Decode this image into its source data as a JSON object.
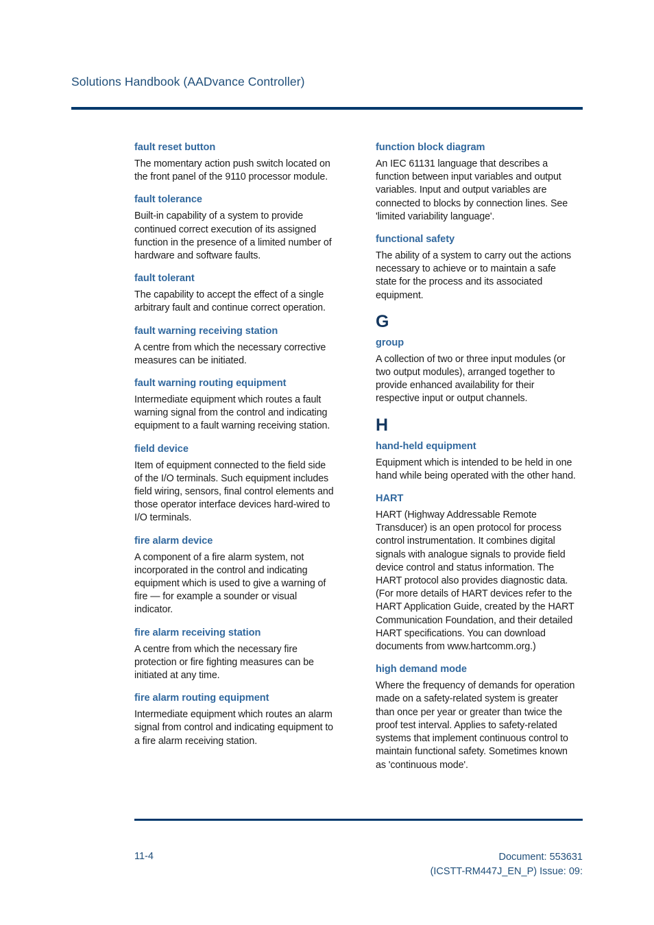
{
  "document": {
    "header_title": "Solutions Handbook (AADvance Controller)",
    "accent_rule_color": "#00386B",
    "term_color": "#31689E",
    "letter_color": "#13365E",
    "footer_color": "#1F4E79"
  },
  "columns": {
    "left": [
      {
        "kind": "entry",
        "term": "fault reset button",
        "definition": "The momentary action push switch located on the front panel of the 9110 processor module."
      },
      {
        "kind": "entry",
        "term": "fault tolerance",
        "definition": "Built-in capability of a system to provide continued correct execution of its assigned function in the presence of a limited number of hardware and software faults."
      },
      {
        "kind": "entry",
        "term": "fault tolerant",
        "definition": "The capability to accept the effect of a single arbitrary fault and continue correct operation."
      },
      {
        "kind": "entry",
        "term": "fault warning receiving station",
        "definition": "A centre from which the necessary corrective measures can be initiated."
      },
      {
        "kind": "entry",
        "term": "fault warning routing equipment",
        "definition": "Intermediate equipment which routes a fault warning signal from the control and indicating equipment to a fault warning receiving station."
      },
      {
        "kind": "entry",
        "term": "field device",
        "definition": "Item of equipment connected to the field side of the I/O terminals. Such equipment includes field wiring, sensors, final control elements and those operator interface devices hard-wired to I/O terminals."
      },
      {
        "kind": "entry",
        "term": "fire alarm device",
        "definition": "A component of a fire alarm system, not incorporated in the control and indicating equipment which is used to give a warning of fire — for example a sounder or visual indicator."
      },
      {
        "kind": "entry",
        "term": "fire alarm receiving station",
        "definition": "A centre from which the necessary fire protection or fire fighting measures can be initiated at any time."
      },
      {
        "kind": "entry",
        "term": "fire alarm routing equipment",
        "definition": "Intermediate equipment which routes an alarm signal from control and indicating equipment to a fire alarm receiving station."
      }
    ],
    "right": [
      {
        "kind": "entry",
        "term": "function block diagram",
        "definition": "An IEC 61131 language that describes a function between input variables and output variables. Input and output variables are connected to blocks by connection lines. See 'limited variability language'."
      },
      {
        "kind": "entry",
        "term": "functional safety",
        "definition": "The ability of a system to carry out the actions necessary to achieve or to maintain a safe state for the process and its associated equipment."
      },
      {
        "kind": "letter",
        "letter": "G"
      },
      {
        "kind": "entry",
        "term": "group",
        "definition": "A collection of two or three input modules (or two output modules), arranged together to provide enhanced availability for their respective input or output channels."
      },
      {
        "kind": "letter",
        "letter": "H"
      },
      {
        "kind": "entry",
        "term": "hand-held equipment",
        "definition": "Equipment which is intended to be held in one hand while being operated with the other hand."
      },
      {
        "kind": "entry",
        "term": "HART",
        "definition": "HART (Highway Addressable Remote Transducer) is an open protocol for process control instrumentation. It combines digital signals with analogue signals to provide field device control and status information. The HART protocol also provides diagnostic data. (For more details of HART devices refer to the HART Application Guide, created by the HART Communication Foundation, and their detailed HART specifications. You can download documents from www.hartcomm.org.)"
      },
      {
        "kind": "entry",
        "term": "high demand mode",
        "definition": "Where the frequency of demands for operation made on a safety-related system is greater than once per year or greater than twice the proof test interval. Applies to safety-related systems that implement continuous control to maintain functional safety. Sometimes known as 'continuous mode'."
      }
    ]
  },
  "footer": {
    "page_number": "11-4",
    "document_number": "Document: 553631",
    "document_revision": "(ICSTT-RM447J_EN_P) Issue: 09:"
  }
}
